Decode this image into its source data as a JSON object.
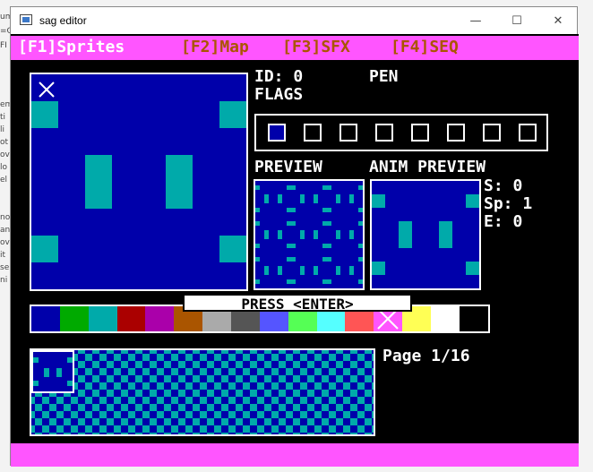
{
  "window": {
    "title": "sag editor"
  },
  "menu": {
    "sprites": "[F1]Sprites",
    "map": "[F2]Map",
    "sfx": "[F3]SFX",
    "seq": "[F4]SEQ"
  },
  "info": {
    "id_label": "ID: 0",
    "pen_label": "PEN",
    "flags_label": "FLAGS",
    "flags": [
      true,
      false,
      false,
      false,
      false,
      false,
      false,
      false
    ],
    "preview_label": "PREVIEW",
    "anim_preview_label": "ANIM PREVIEW",
    "s_label": "S: 0",
    "sp_label": "Sp: 1",
    "e_label": "E: 0"
  },
  "press_enter": "PRESS <ENTER>",
  "palette": [
    "#0000aa",
    "#00aa00",
    "#00aaaa",
    "#aa0000",
    "#aa00aa",
    "#aa5500",
    "#aaaaaa",
    "#555555",
    "#5555ff",
    "#55ff55",
    "#55ffff",
    "#ff5555",
    "#ff55ff",
    "#ffff55",
    "#ffffff",
    "#000000"
  ],
  "selected_palette_index": 12,
  "page_label": "Page 1/16",
  "colors": {
    "menu_bg": "#ff55ff",
    "menu_active": "#ffffff",
    "menu_inactive": "#aa5500",
    "sprite_bg": "#0000aa",
    "sprite_fg": "#00aaaa"
  }
}
